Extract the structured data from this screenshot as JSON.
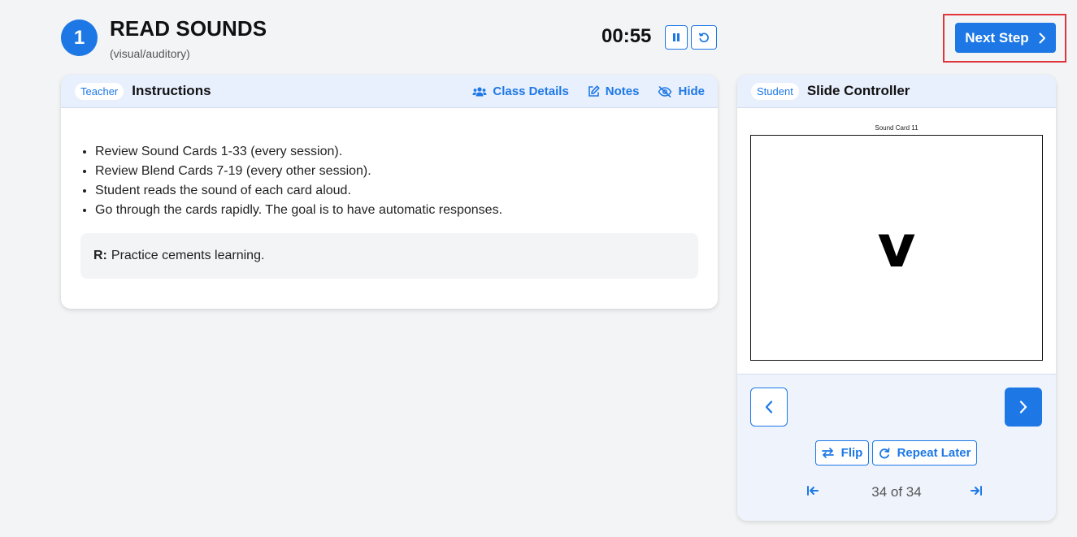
{
  "step": {
    "number": "1",
    "title": "READ SOUNDS",
    "subtitle": "(visual/auditory)"
  },
  "timer": {
    "time": "00:55",
    "pause_icon": "pause-icon",
    "reset_icon": "reset-icon"
  },
  "next_step": {
    "label": "Next Step",
    "icon": "chevron-right-icon"
  },
  "instructions_panel": {
    "role": "Teacher",
    "title": "Instructions",
    "actions": [
      {
        "label": "Class Details",
        "icon": "users-icon"
      },
      {
        "label": "Notes",
        "icon": "edit-icon"
      },
      {
        "label": "Hide",
        "icon": "eye-off-icon"
      }
    ],
    "items": [
      "Review Sound Cards 1-33 (every session).",
      "Review Blend Cards 7-19 (every other session).",
      "Student reads the sound of each card aloud.",
      "Go through the cards rapidly. The goal is to have automatic responses."
    ],
    "reason_label": "R:",
    "reason_text": "Practice cements learning."
  },
  "slide_controller": {
    "role": "Student",
    "title": "Slide Controller",
    "card_caption": "Sound Card 11",
    "card_letter": "v",
    "flip_label": "Flip",
    "repeat_label": "Repeat Later",
    "pager": "34 of 34"
  },
  "colors": {
    "accent": "#1d78e6",
    "highlight_outline": "#e0363b",
    "header_bg": "#e8effd"
  }
}
